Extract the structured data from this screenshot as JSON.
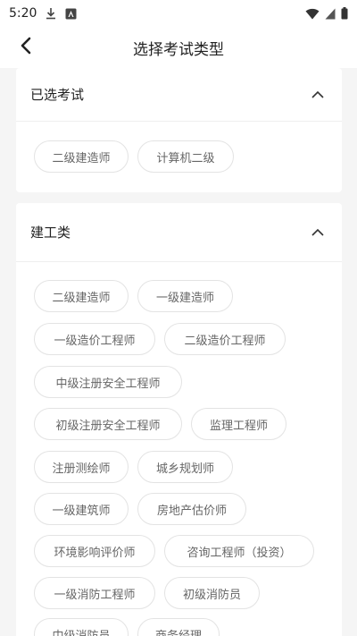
{
  "status_bar": {
    "time": "5:20",
    "icons": [
      "download-icon",
      "notification-a-icon",
      "wifi-icon",
      "cell-signal-icon",
      "battery-icon"
    ]
  },
  "nav": {
    "title": "选择考试类型",
    "back_icon": "back-arrow-icon"
  },
  "selected_section": {
    "title": "已选考试",
    "items": [
      "二级建造师",
      "计算机二级"
    ]
  },
  "construction_section": {
    "title": "建工类",
    "items": [
      "二级建造师",
      "一级建造师",
      "一级造价工程师",
      "二级造价工程师",
      "中级注册安全工程师",
      "初级注册安全工程师",
      "监理工程师",
      "注册测绘师",
      "城乡规划师",
      "一级建筑师",
      "房地产估价师",
      "环境影响评价师",
      "咨询工程师（投资）",
      "一级消防工程师",
      "初级消防员",
      "中级消防员",
      "商务经理"
    ]
  },
  "colors": {
    "background": "#f5f5f5",
    "card": "#ffffff",
    "chip_border": "#e3e3e3",
    "chip_text": "#666666"
  }
}
